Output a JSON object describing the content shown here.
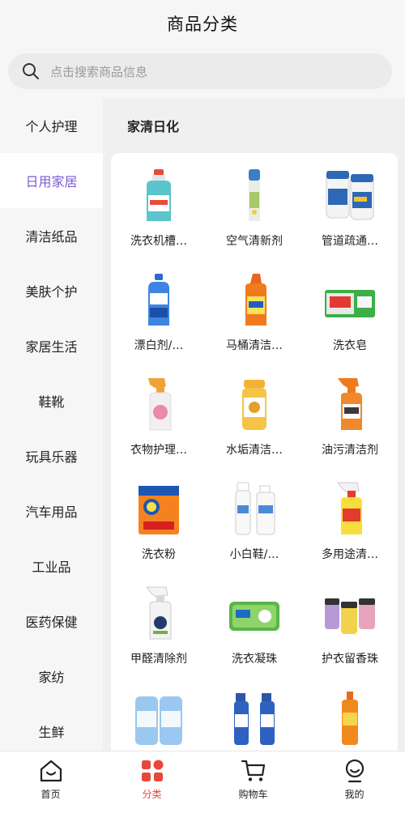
{
  "header": {
    "title": "商品分类"
  },
  "search": {
    "placeholder": "点击搜索商品信息",
    "icon": "search-icon"
  },
  "sidebar": {
    "items": [
      {
        "label": "个人护理"
      },
      {
        "label": "日用家居"
      },
      {
        "label": "清洁纸品"
      },
      {
        "label": "美肤个护"
      },
      {
        "label": "家居生活"
      },
      {
        "label": "鞋靴"
      },
      {
        "label": "玩具乐器"
      },
      {
        "label": "汽车用品"
      },
      {
        "label": "工业品"
      },
      {
        "label": "医药保健"
      },
      {
        "label": "家纺"
      },
      {
        "label": "生鲜"
      }
    ],
    "active_index": 1,
    "active_color": "#7b5cd6"
  },
  "content": {
    "title": "家清日化",
    "products": [
      {
        "name": "洗衣机槽…"
      },
      {
        "name": "空气清新剂"
      },
      {
        "name": "管道疏通…"
      },
      {
        "name": "漂白剂/…"
      },
      {
        "name": "马桶清洁…"
      },
      {
        "name": "洗衣皂"
      },
      {
        "name": "衣物护理…"
      },
      {
        "name": "水垢清洁…"
      },
      {
        "name": "油污清洁剂"
      },
      {
        "name": "洗衣粉"
      },
      {
        "name": "小白鞋/…"
      },
      {
        "name": "多用途清…"
      },
      {
        "name": "甲醛清除剂"
      },
      {
        "name": "洗衣凝珠"
      },
      {
        "name": "护衣留香珠"
      },
      {
        "name": ""
      },
      {
        "name": ""
      },
      {
        "name": ""
      }
    ]
  },
  "tabbar": {
    "items": [
      {
        "label": "首页",
        "icon": "home-icon"
      },
      {
        "label": "分类",
        "icon": "category-icon"
      },
      {
        "label": "购物车",
        "icon": "cart-icon"
      },
      {
        "label": "我的",
        "icon": "profile-icon"
      }
    ],
    "active_index": 1,
    "active_color": "#e8463a"
  }
}
